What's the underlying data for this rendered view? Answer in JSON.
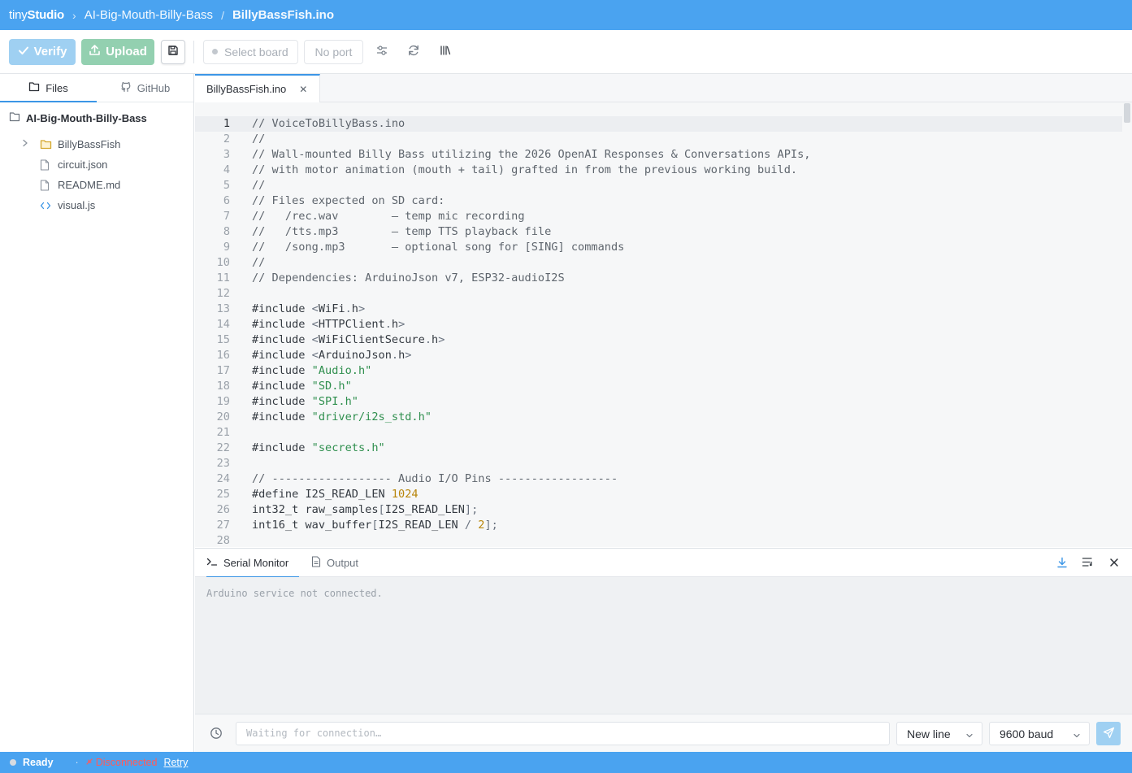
{
  "titlebar": {
    "brand_light": "tiny",
    "brand_bold": "Studio",
    "project": "AI-Big-Mouth-Billy-Bass",
    "file": "BillyBassFish.ino"
  },
  "toolbar": {
    "verify_label": "Verify",
    "upload_label": "Upload",
    "board_label": "Select board",
    "port_label": "No port"
  },
  "sidebar": {
    "tabs": [
      {
        "label": "Files",
        "icon": "folder-icon",
        "active": true
      },
      {
        "label": "GitHub",
        "icon": "github-icon",
        "active": false
      }
    ],
    "root": "AI-Big-Mouth-Billy-Bass",
    "items": [
      {
        "label": "BillyBassFish",
        "type": "folder"
      },
      {
        "label": "circuit.json",
        "type": "file"
      },
      {
        "label": "README.md",
        "type": "file"
      },
      {
        "label": "visual.js",
        "type": "code"
      }
    ]
  },
  "editor": {
    "tab_label": "BillyBassFish.ino",
    "current_line": 1,
    "lines": [
      {
        "n": "1",
        "parts": [
          {
            "t": "// VoiceToBillyBass.ino",
            "c": "com"
          }
        ]
      },
      {
        "n": "2",
        "parts": [
          {
            "t": "//",
            "c": "com"
          }
        ]
      },
      {
        "n": "3",
        "parts": [
          {
            "t": "// Wall-mounted Billy Bass utilizing the 2026 OpenAI Responses & Conversations APIs,",
            "c": "com"
          }
        ]
      },
      {
        "n": "4",
        "parts": [
          {
            "t": "// with motor animation (mouth + tail) grafted in from the previous working build.",
            "c": "com"
          }
        ]
      },
      {
        "n": "5",
        "parts": [
          {
            "t": "//",
            "c": "com"
          }
        ]
      },
      {
        "n": "6",
        "parts": [
          {
            "t": "// Files expected on SD card:",
            "c": "com"
          }
        ]
      },
      {
        "n": "7",
        "parts": [
          {
            "t": "//   /rec.wav        – temp mic recording",
            "c": "com"
          }
        ]
      },
      {
        "n": "8",
        "parts": [
          {
            "t": "//   /tts.mp3        – temp TTS playback file",
            "c": "com"
          }
        ]
      },
      {
        "n": "9",
        "parts": [
          {
            "t": "//   /song.mp3       – optional song for [SING] commands",
            "c": "com"
          }
        ]
      },
      {
        "n": "10",
        "parts": [
          {
            "t": "//",
            "c": "com"
          }
        ]
      },
      {
        "n": "11",
        "parts": [
          {
            "t": "// Dependencies: ArduinoJson v7, ESP32-audioI2S",
            "c": "com"
          }
        ]
      },
      {
        "n": "12",
        "parts": []
      },
      {
        "n": "13",
        "parts": [
          {
            "t": "#include ",
            "c": ""
          },
          {
            "t": "<",
            "c": "punc"
          },
          {
            "t": "WiFi",
            "c": ""
          },
          {
            "t": ".",
            "c": "punc"
          },
          {
            "t": "h",
            "c": ""
          },
          {
            "t": ">",
            "c": "punc"
          }
        ]
      },
      {
        "n": "14",
        "parts": [
          {
            "t": "#include ",
            "c": ""
          },
          {
            "t": "<",
            "c": "punc"
          },
          {
            "t": "HTTPClient",
            "c": ""
          },
          {
            "t": ".",
            "c": "punc"
          },
          {
            "t": "h",
            "c": ""
          },
          {
            "t": ">",
            "c": "punc"
          }
        ]
      },
      {
        "n": "15",
        "parts": [
          {
            "t": "#include ",
            "c": ""
          },
          {
            "t": "<",
            "c": "punc"
          },
          {
            "t": "WiFiClientSecure",
            "c": ""
          },
          {
            "t": ".",
            "c": "punc"
          },
          {
            "t": "h",
            "c": ""
          },
          {
            "t": ">",
            "c": "punc"
          }
        ]
      },
      {
        "n": "16",
        "parts": [
          {
            "t": "#include ",
            "c": ""
          },
          {
            "t": "<",
            "c": "punc"
          },
          {
            "t": "ArduinoJson",
            "c": ""
          },
          {
            "t": ".",
            "c": "punc"
          },
          {
            "t": "h",
            "c": ""
          },
          {
            "t": ">",
            "c": "punc"
          }
        ]
      },
      {
        "n": "17",
        "parts": [
          {
            "t": "#include ",
            "c": ""
          },
          {
            "t": "\"Audio.h\"",
            "c": "str"
          }
        ]
      },
      {
        "n": "18",
        "parts": [
          {
            "t": "#include ",
            "c": ""
          },
          {
            "t": "\"SD.h\"",
            "c": "str"
          }
        ]
      },
      {
        "n": "19",
        "parts": [
          {
            "t": "#include ",
            "c": ""
          },
          {
            "t": "\"SPI.h\"",
            "c": "str"
          }
        ]
      },
      {
        "n": "20",
        "parts": [
          {
            "t": "#include ",
            "c": ""
          },
          {
            "t": "\"driver/i2s_std.h\"",
            "c": "str"
          }
        ]
      },
      {
        "n": "21",
        "parts": []
      },
      {
        "n": "22",
        "parts": [
          {
            "t": "#include ",
            "c": ""
          },
          {
            "t": "\"secrets.h\"",
            "c": "str"
          }
        ]
      },
      {
        "n": "23",
        "parts": []
      },
      {
        "n": "24",
        "parts": [
          {
            "t": "// ------------------ Audio I/O Pins ------------------",
            "c": "com"
          }
        ]
      },
      {
        "n": "25",
        "parts": [
          {
            "t": "#define I2S_READ_LEN ",
            "c": ""
          },
          {
            "t": "1024",
            "c": "num"
          }
        ]
      },
      {
        "n": "26",
        "parts": [
          {
            "t": "int32_t raw_samples",
            "c": ""
          },
          {
            "t": "[",
            "c": "punc"
          },
          {
            "t": "I2S_READ_LEN",
            "c": ""
          },
          {
            "t": "];",
            "c": "punc"
          }
        ]
      },
      {
        "n": "27",
        "parts": [
          {
            "t": "int16_t wav_buffer",
            "c": ""
          },
          {
            "t": "[",
            "c": "punc"
          },
          {
            "t": "I2S_READ_LEN ",
            "c": ""
          },
          {
            "t": "/",
            "c": "punc"
          },
          {
            "t": " ",
            "c": ""
          },
          {
            "t": "2",
            "c": "num"
          },
          {
            "t": "];",
            "c": "punc"
          }
        ]
      },
      {
        "n": "28",
        "parts": []
      }
    ]
  },
  "panel": {
    "tabs": [
      {
        "label": "Serial Monitor",
        "icon": "terminal-icon",
        "active": true
      },
      {
        "label": "Output",
        "icon": "document-icon",
        "active": false
      }
    ],
    "serial_message": "Arduino service not connected.",
    "input_placeholder": "Waiting for connection…",
    "line_ending": "New line",
    "baud": "9600 baud"
  },
  "statusbar": {
    "ready": "Ready",
    "disconnected": "Disconnected",
    "retry": "Retry"
  },
  "colors": {
    "accent": "#4aa3f0",
    "verify": "#9fd0f2",
    "upload": "#93d0b0",
    "string": "#2f8f4e",
    "number": "#b8860b",
    "error": "#ff5b5b"
  }
}
